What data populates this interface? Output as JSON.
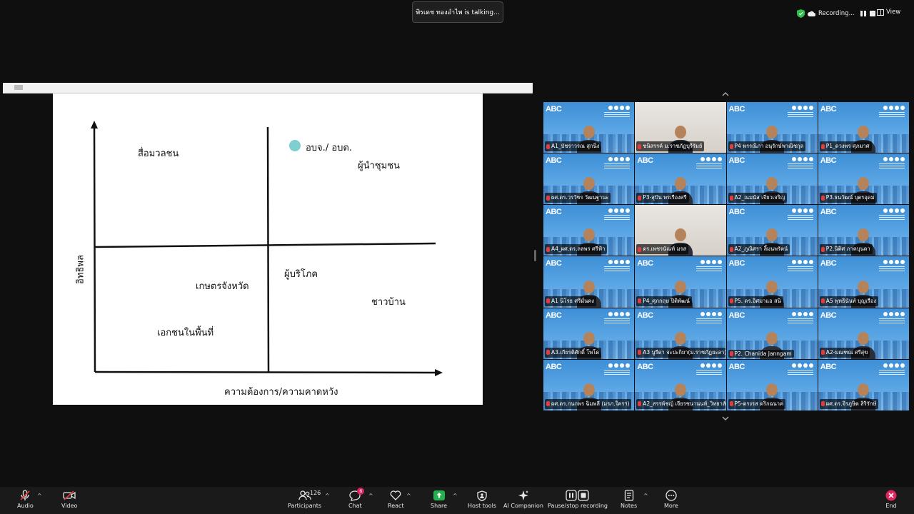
{
  "talking_notice": "พิรเดช ทองอำไพ is talking...",
  "recording": {
    "label": "Recording..."
  },
  "view_button": {
    "label": "View"
  },
  "slide": {
    "y_axis_label": "อิทธิพล",
    "x_axis_label": "ความต้องการ/ความคาดหวัง",
    "top_left": "สื่อมวลชน",
    "top_right_dot_label": "อบจ./ อบต.",
    "top_right": "ผู้นำชุมชน",
    "bottom_left_1": "เกษตรจังหวัด",
    "bottom_left_2": "เอกชนในพื้นที่",
    "bottom_right_1": "ผู้บริโภค",
    "bottom_right_2": "ชาวบ้าน",
    "dot_color": "#7ecfcf"
  },
  "gallery": {
    "tiles": [
      {
        "name": "A1_บัชราวรณ สุกนิ่ง",
        "type": "abc"
      },
      {
        "name": "ชนิสรรค์ ม.ราชภัฏบุรีรัมย์",
        "type": "cam"
      },
      {
        "name": "P4 พรรณิภา อนุรักษ์พาณิชกุล",
        "type": "abc"
      },
      {
        "name": "P1_ดวงพร ศุภมาศ",
        "type": "abc"
      },
      {
        "name": "ผศ.ดร.วรวัชร วัฒนฐานะ",
        "type": "abc"
      },
      {
        "name": "P3-สุปัน พรเรืองศรี",
        "type": "abc"
      },
      {
        "name": "A2_ณมนัส เจียวเจริญ",
        "type": "abc"
      },
      {
        "name": "P3.ธนวัฒน์ บุตรอุดม",
        "type": "abc"
      },
      {
        "name": "A4_ผศ.ดร.ลลพร ศรีฟ้า",
        "type": "abc"
      },
      {
        "name": "ดร.เพชรนัณท์ มรส",
        "type": "cam"
      },
      {
        "name": "A2_ภูณิศรา ลิ้มนพรัตน์",
        "type": "abc"
      },
      {
        "name": "P2.นิติศ ภาคบุนดา",
        "type": "abc"
      },
      {
        "name": "A1 นิโรธ ศรีมั่นคง",
        "type": "abc"
      },
      {
        "name": "P4_ศุภกฤษ ปิติพัฒน์",
        "type": "abc"
      },
      {
        "name": "P5. ดร.อิศมาแอ สนิ",
        "type": "abc"
      },
      {
        "name": "A5 พุทธินันท์ บุญเรือง",
        "type": "abc"
      },
      {
        "name": "A3.เกียรติศักดิ์ โพโด",
        "type": "abc"
      },
      {
        "name": "A3 นูรีดา จะปะกิยา(ม.ราชภัฏยะลา)",
        "type": "abc"
      },
      {
        "name": "P2. Chanida Janngam",
        "type": "abc"
      },
      {
        "name": "A2-มณฑณ ศรีสุข",
        "type": "abc"
      },
      {
        "name": "ผศ.ดร.กนกพร ฉิมพลี (มรภ.ใครฯ)",
        "type": "abc"
      },
      {
        "name": "A2_สรรพ์ชญ์ เจียรชนานนท์_วิทยาลัย",
        "type": "abc"
      },
      {
        "name": "P5-ดรงรส ดริกฉนาค",
        "type": "abc"
      },
      {
        "name": "ผศ.ดร.จิรภูษิต สิริรักษ์",
        "type": "abc"
      }
    ],
    "logo_text": "ABC"
  },
  "toolbar": {
    "audio": "Audio",
    "video": "Video",
    "participants": "Participants",
    "participants_count": "126",
    "chat": "Chat",
    "chat_badge": "6",
    "react": "React",
    "share": "Share",
    "host_tools": "Host tools",
    "ai_companion": "AI Companion",
    "pause_stop": "Pause/stop recording",
    "notes": "Notes",
    "more": "More",
    "end": "End"
  },
  "colors": {
    "share_green": "#22b14c",
    "end_red": "#e0245e",
    "recording_shield": "#2fbf4a"
  }
}
